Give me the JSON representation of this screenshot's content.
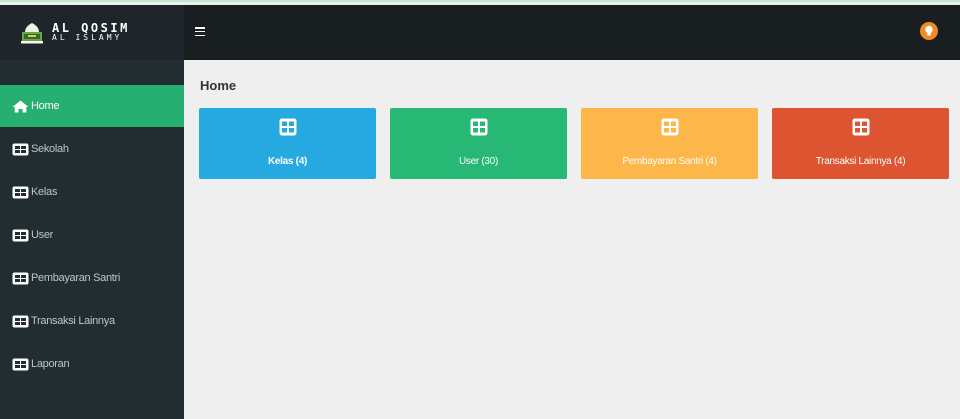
{
  "brand": {
    "line1": "AL QOSIM",
    "line2": "AL ISLAMY"
  },
  "sidebar": {
    "items": [
      {
        "label": "Home",
        "icon": "home-icon",
        "active": true
      },
      {
        "label": "Sekolah",
        "icon": "grid-icon"
      },
      {
        "label": "Kelas",
        "icon": "grid-icon"
      },
      {
        "label": "User",
        "icon": "grid-icon"
      },
      {
        "label": "Pembayaran Santri",
        "icon": "grid-icon"
      },
      {
        "label": "Transaksi Lainnya",
        "icon": "grid-icon"
      },
      {
        "label": "Laporan",
        "icon": "grid-icon"
      }
    ]
  },
  "page": {
    "title": "Home"
  },
  "cards": [
    {
      "label": "Kelas (4)",
      "color": "#26a8e0",
      "icon": "grid-icon"
    },
    {
      "label": "User (30)",
      "color": "#27b876",
      "icon": "grid-icon"
    },
    {
      "label": "Pembayaran Santri (4)",
      "color": "#fdb649",
      "icon": "grid-icon"
    },
    {
      "label": "Transaksi Lainnya (4)",
      "color": "#dd5430",
      "icon": "grid-icon"
    }
  ],
  "colors": {
    "sidebar": "#222d32",
    "topbar": "#191e21",
    "active": "#27ae71",
    "avatar": "#f08a24"
  }
}
